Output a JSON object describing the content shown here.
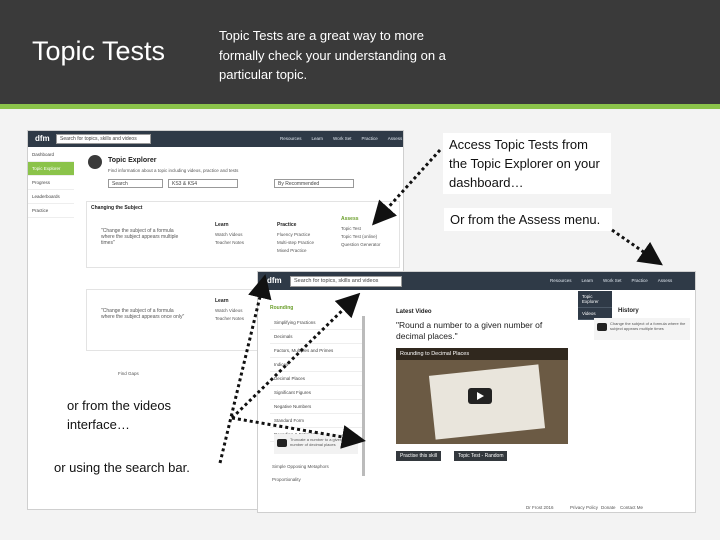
{
  "header": {
    "title": "Topic Tests",
    "description": "Topic Tests are a great way to more formally check your understanding on a particular topic."
  },
  "callouts": {
    "topic_explorer": "Access Topic Tests from the Topic Explorer on your dashboard…",
    "assess_menu": "Or from the Assess menu.",
    "videos": "or from the videos interface…",
    "search": "or using the search bar."
  },
  "screen1": {
    "logo": "dfm",
    "search_placeholder": "Search for topics, skills and videos",
    "nav": [
      "Resources",
      "Learn",
      "Work Set",
      "Practice",
      "Assess"
    ],
    "sidebar": [
      "Dashboard",
      "Topic Explorer",
      "Progress",
      "Leaderboards",
      "Practice"
    ],
    "panel_title": "Topic Explorer",
    "panel_desc": "Find information about a topic including videos, practice and tests",
    "search_label": "Search",
    "filter": "KS3 & KS4",
    "sort": "By Recommended",
    "section_title": "Changing the Subject",
    "quote1": "\"Change the subject of a formula where the subject appears multiple times\"",
    "quote2": "\"Change the subject of a formula where the subject appears once only\"",
    "col_learn": "Learn",
    "col_practice": "Practice",
    "col_assess": "Assess",
    "learn_items": [
      "Watch Videos",
      "Teacher Notes"
    ],
    "practice_items": [
      "Fluency Practice",
      "Multi-step Practice",
      "Mixed Practice"
    ],
    "assess_items": [
      "Topic Test",
      "Topic Test (online)",
      "Question Generator"
    ],
    "more": "Find Gaps"
  },
  "screen2": {
    "logo": "dfm",
    "search_placeholder": "Search for topics, skills and videos",
    "nav": [
      "Resources",
      "Learn",
      "Work Set",
      "Practice",
      "Assess"
    ],
    "dropdown": [
      "Topic Explorer",
      "Videos"
    ],
    "sidebar_header": "Rounding",
    "sidebar": [
      "Simplifying Fractions",
      "Decimals",
      "Factors, Multiples and Primes",
      "Indices",
      "Decimal Places",
      "Significant Figures",
      "Negative Numbers",
      "Standard Form",
      "Rounding & Estimation"
    ],
    "latest_label": "Latest Video",
    "video_title": "\"Round a number to a given number of decimal places.\"",
    "video_caption": "Rounding to Decimal Places",
    "btn_practise": "Practise this skill",
    "btn_test": "Topic Test - Random",
    "history_title": "History",
    "history_item": "Change the subject of a formula where the subject appears multiple times",
    "sub_item": "Truncate a number to a given number of decimal places",
    "footer_date": "Dr Frost 2016",
    "footer_links": [
      "Privacy Policy",
      "Donate",
      "Contact Me"
    ],
    "bottom_item": "Simple Opposing Metaphors",
    "bottom_item2": "Proportionality"
  }
}
